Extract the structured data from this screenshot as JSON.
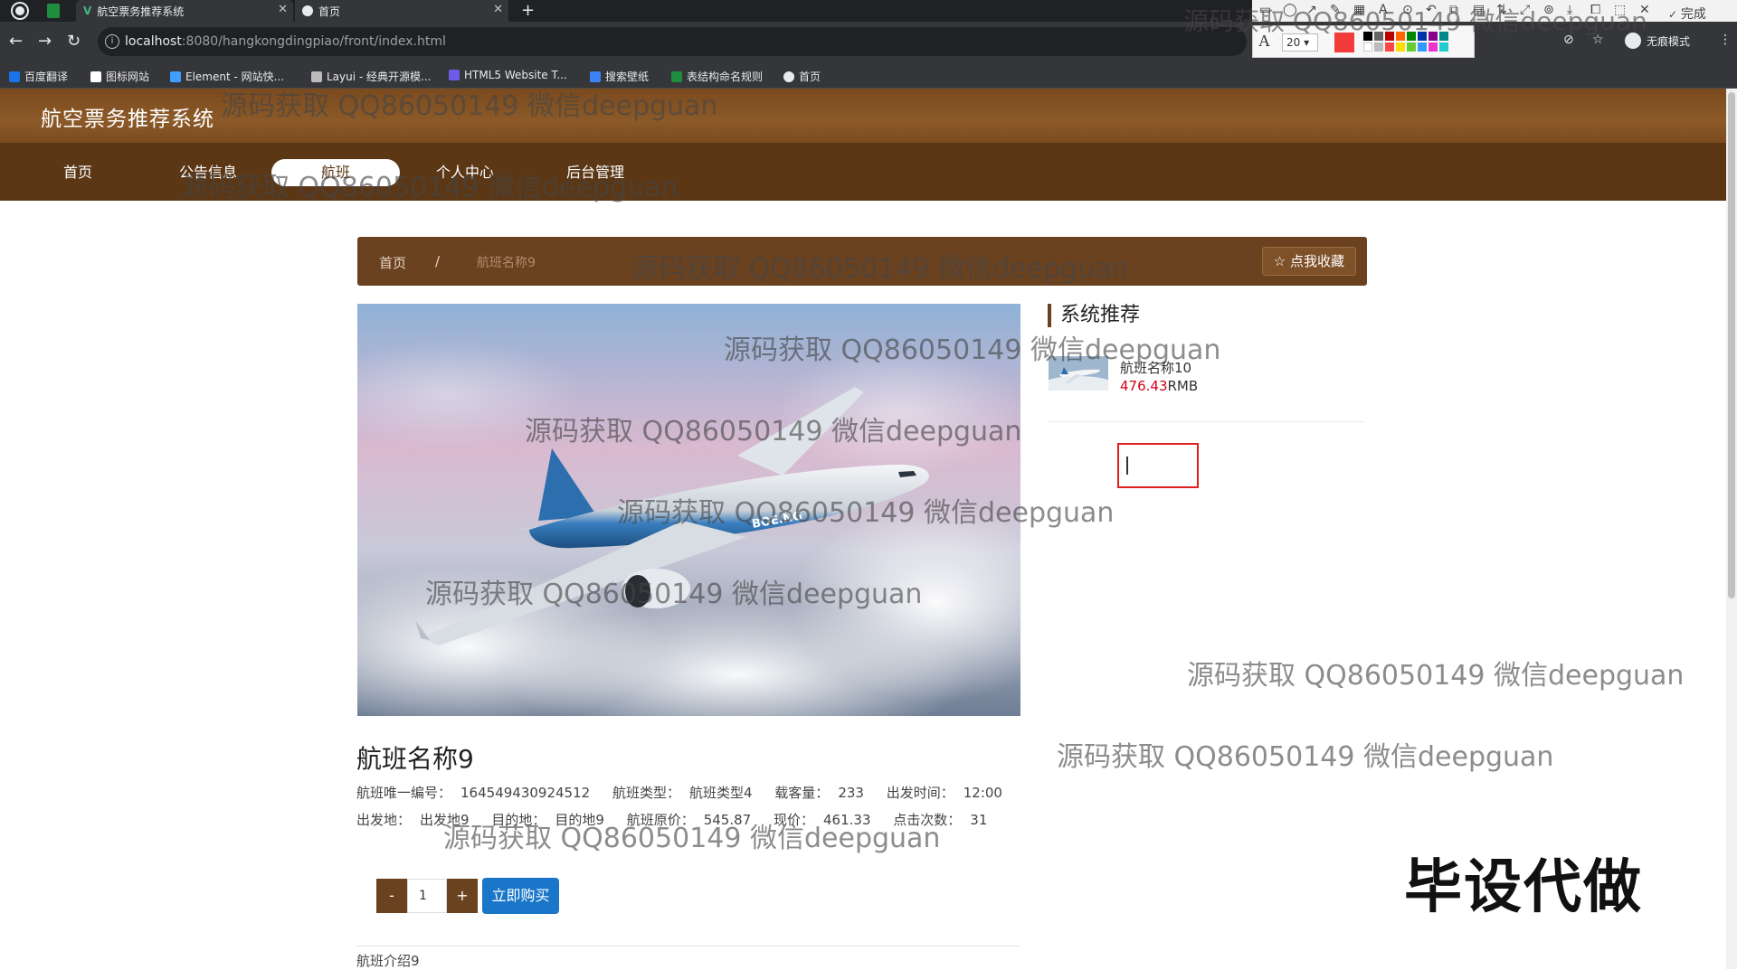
{
  "browser": {
    "tabs": [
      {
        "title": "航空票务推荐系统"
      },
      {
        "title": "首页"
      }
    ],
    "url_host": "localhost",
    "url_path": ":8080/hangkongdingpiao/front/index.html",
    "incognito_label": "无痕模式",
    "bookmarks": [
      {
        "label": "百度翻译",
        "color": "#1a73e8"
      },
      {
        "label": "图标网站",
        "color": "#ffffff"
      },
      {
        "label": "Element - 网站快...",
        "color": "#409eff"
      },
      {
        "label": "Layui - 经典开源模...",
        "color": "#bbbbbb"
      },
      {
        "label": "HTML5 Website T...",
        "color": "#6c5ce7"
      },
      {
        "label": "搜索壁纸",
        "color": "#3b82f6"
      },
      {
        "label": "表结构命名规则",
        "color": "#1e8e3e"
      },
      {
        "label": "首页",
        "color": "#e8eaed"
      }
    ]
  },
  "snip_tool": {
    "font_size": "20",
    "done_label": "完成",
    "active_color": "#f23c3c"
  },
  "site": {
    "title": "航空票务推荐系统",
    "nav": [
      {
        "label": "首页"
      },
      {
        "label": "公告信息"
      },
      {
        "label": "航班"
      },
      {
        "label": "个人中心"
      },
      {
        "label": "后台管理"
      }
    ]
  },
  "breadcrumb": {
    "home": "首页",
    "sep": "/",
    "current": "航班名称9",
    "favorite_label": "点我收藏"
  },
  "flight": {
    "name": "航班名称9",
    "line1": [
      {
        "label": "航班唯一编号：",
        "value": "164549430924512"
      },
      {
        "label": "航班类型：",
        "value": "航班类型4"
      },
      {
        "label": "载客量：",
        "value": "233"
      },
      {
        "label": "出发时间：",
        "value": "12:00"
      }
    ],
    "line2": [
      {
        "label": "出发地：",
        "value": "出发地9"
      },
      {
        "label": "目的地：",
        "value": "目的地9"
      },
      {
        "label": "航班原价：",
        "value": "545.87"
      },
      {
        "label": "现价：",
        "value": "461.33"
      },
      {
        "label": "点击次数：",
        "value": "31"
      }
    ],
    "quantity": "1",
    "minus_label": "-",
    "plus_label": "+",
    "buy_label": "立即购买",
    "intro": "航班介绍9"
  },
  "sidebar": {
    "title": "系统推荐",
    "items": [
      {
        "name": "航班名称10",
        "price": "476.43",
        "unit": "RMB"
      }
    ]
  },
  "watermark": {
    "text": "源码获取 QQ86050149 微信deepguan",
    "badge": "毕设代做"
  },
  "colors": {
    "header_brown": "#7a4a1e",
    "nav_brown": "#5b3716",
    "breadcrumb_brown": "#6b4220",
    "buy_blue": "#1976c8",
    "price_red": "#d0021b"
  }
}
